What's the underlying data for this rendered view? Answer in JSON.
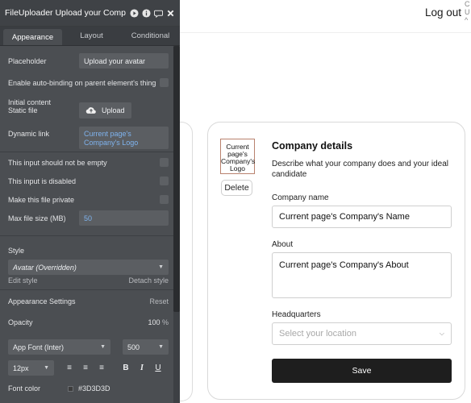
{
  "editor": {
    "title": "FileUploader Upload your Comp",
    "header_icons": [
      "play-icon",
      "info-icon",
      "comment-icon",
      "close-icon"
    ],
    "tabs": [
      {
        "label": "Appearance",
        "active": true
      },
      {
        "label": "Layout",
        "active": false
      },
      {
        "label": "Conditional",
        "active": false
      }
    ],
    "placeholder_label": "Placeholder",
    "placeholder_value": "Upload your avatar",
    "auto_binding_label": "Enable auto-binding on parent element's thing",
    "initial_content_label": "Initial content",
    "static_file_label": "Static file",
    "upload_label": "Upload",
    "dynamic_link_label": "Dynamic link",
    "dynamic_link_value": "Current page's Company's Logo",
    "not_empty_label": "This input should not be empty",
    "disabled_label": "This input is disabled",
    "private_label": "Make this file private",
    "max_size_label": "Max file size (MB)",
    "max_size_value": "50",
    "style_label": "Style",
    "style_value": "Avatar (Overridden)",
    "edit_style_label": "Edit style",
    "detach_style_label": "Detach style",
    "appearance_settings_label": "Appearance Settings",
    "reset_label": "Reset",
    "opacity_label": "Opacity",
    "opacity_value": "100",
    "opacity_unit": "%",
    "font_value": "App Font (Inter)",
    "font_weight_value": "500",
    "font_size_value": "12px",
    "bold_label": "B",
    "italic_label": "I",
    "underline_label": "U",
    "font_color_label": "Font color",
    "font_color_value": "#3D3D3D"
  },
  "canvas": {
    "logout_label": "Log out",
    "edge_text": "C\nU\n^",
    "logo_text": "Current page's Company's Logo",
    "delete_label": "Delete",
    "section_title": "Company details",
    "section_description": "Describe what your company does and your ideal candidate",
    "company_name_label": "Company name",
    "company_name_value": "Current page's Company's Name",
    "about_label": "About",
    "about_value": "Current page's Company's About",
    "headquarters_label": "Headquarters",
    "headquarters_placeholder": "Select your location",
    "save_label": "Save"
  },
  "colors": {
    "panel_bg": "#4b4e52",
    "link": "#7fb3ee",
    "save_button": "#1e1e1e",
    "font_color_swatch": "#3d3d3d"
  }
}
